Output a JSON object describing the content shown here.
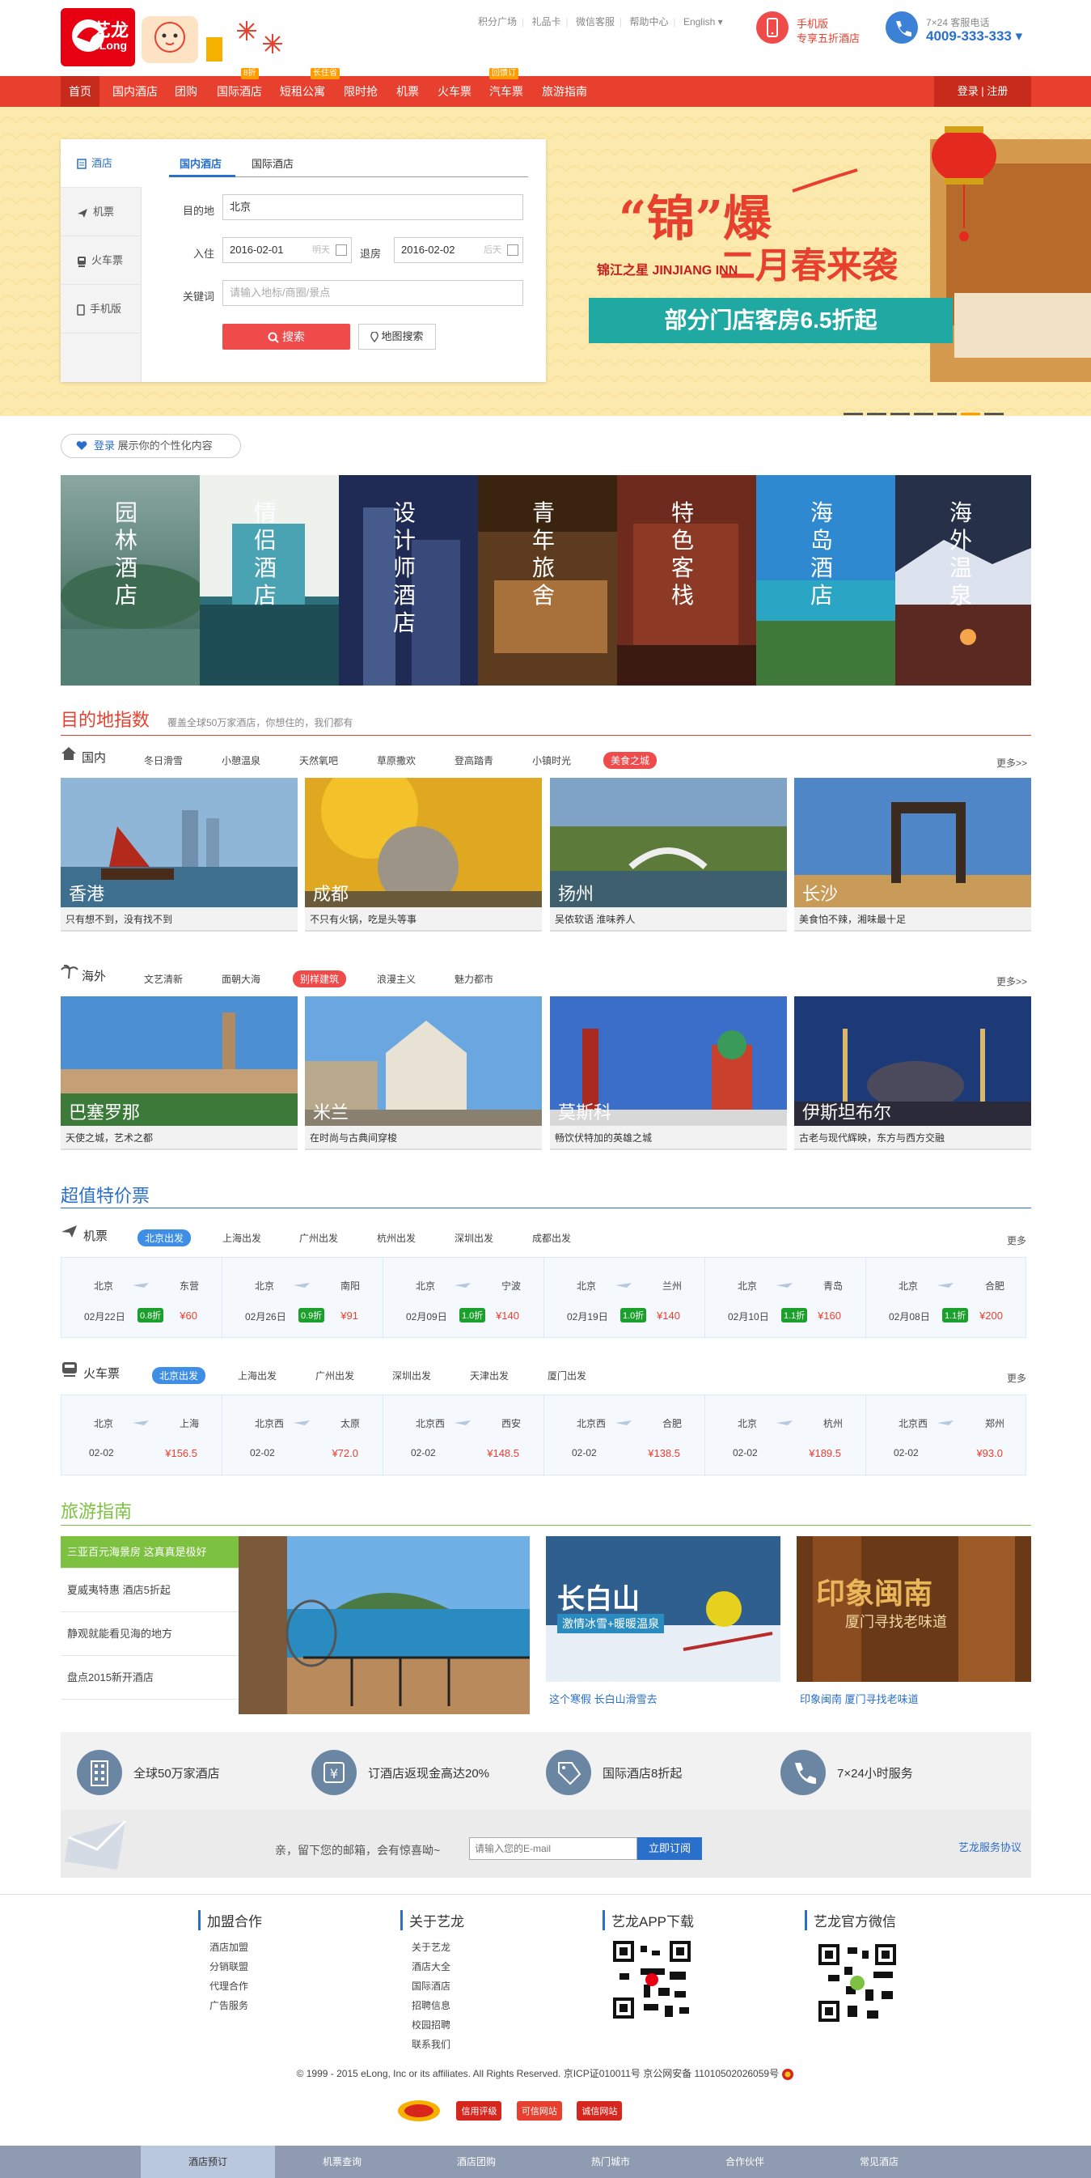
{
  "header": {
    "logo_text": "艺龙",
    "logo_sub": "eLong",
    "top_links": [
      "积分广场",
      "礼品卡",
      "微信客服",
      "帮助中心",
      "English ▾"
    ],
    "mobile_promo": {
      "line1": "手机版",
      "line2": "专享五折酒店"
    },
    "hotline": {
      "label": "7×24 客服电话",
      "number": "4009-333-333 ▾"
    }
  },
  "nav": {
    "items": [
      {
        "label": "首页",
        "badge": ""
      },
      {
        "label": "国内酒店",
        "badge": ""
      },
      {
        "label": "团购",
        "badge": ""
      },
      {
        "label": "国际酒店",
        "badge": "8折"
      },
      {
        "label": "短租公寓",
        "badge": "长住省"
      },
      {
        "label": "限时抢",
        "badge": ""
      },
      {
        "label": "机票",
        "badge": ""
      },
      {
        "label": "火车票",
        "badge": ""
      },
      {
        "label": "汽车票",
        "badge": "回馈订"
      },
      {
        "label": "旅游指南",
        "badge": ""
      }
    ],
    "login_text": "登录 | 注册"
  },
  "search": {
    "side_tabs": [
      "酒店",
      "机票",
      "火车票",
      "手机版"
    ],
    "sub_tabs": [
      "国内酒店",
      "国际酒店"
    ],
    "dest_label": "目的地",
    "dest_value": "北京",
    "checkin_label": "入住",
    "checkin_value": "2016-02-01",
    "checkin_hint": "明天",
    "checkout_label": "退房",
    "checkout_value": "2016-02-02",
    "checkout_hint": "后天",
    "keyword_label": "关键词",
    "keyword_placeholder": "请输入地标/商圈/景点",
    "search_btn": "搜索",
    "map_btn": "地图搜索"
  },
  "banner": {
    "title": "“锦”爆",
    "subtitle": "二月春来袭",
    "brand": "锦江之星 JINJIANG INN",
    "ribbon": "部分门店客房6.5折起"
  },
  "personal": {
    "link": "登录",
    "text": "展示你的个性化内容"
  },
  "themes": [
    "园林酒店",
    "情侣酒店",
    "设计师酒店",
    "青年旅舍",
    "特色客栈",
    "海岛酒店",
    "海外温泉"
  ],
  "destinations": {
    "title": "目的地指数",
    "desc": "覆盖全球50万家酒店，你想住的，我们都有",
    "domestic": {
      "label": "国内",
      "tabs": [
        "冬日滑雪",
        "小憩温泉",
        "天然氧吧",
        "草原撒欢",
        "登高踏青",
        "小镇时光",
        "美食之城"
      ],
      "more": "更多>>",
      "cards": [
        {
          "city": "香港",
          "caption": "只有想不到，没有找不到"
        },
        {
          "city": "成都",
          "caption": "不只有火锅，吃是头等事"
        },
        {
          "city": "扬州",
          "caption": "吴侬软语 淮味养人"
        },
        {
          "city": "长沙",
          "caption": "美食怕不辣，湘味最十足"
        }
      ]
    },
    "overseas": {
      "label": "海外",
      "tabs": [
        "文艺清新",
        "面朝大海",
        "别样建筑",
        "浪漫主义",
        "魅力都市"
      ],
      "more": "更多>>",
      "cards": [
        {
          "city": "巴塞罗那",
          "caption": "天使之城，艺术之都"
        },
        {
          "city": "米兰",
          "caption": "在时尚与古典间穿梭"
        },
        {
          "city": "莫斯科",
          "caption": "畅饮伏特加的英雄之城"
        },
        {
          "city": "伊斯坦布尔",
          "caption": "古老与现代辉映，东方与西方交融"
        }
      ]
    }
  },
  "deals": {
    "title": "超值特价票",
    "flights": {
      "label": "机票",
      "tabs": [
        "北京出发",
        "上海出发",
        "广州出发",
        "杭州出发",
        "深圳出发",
        "成都出发"
      ],
      "more": "更多",
      "items": [
        {
          "from": "北京",
          "to": "东营",
          "date": "02月22日",
          "discount": "0.8折",
          "price": "¥60"
        },
        {
          "from": "北京",
          "to": "南阳",
          "date": "02月26日",
          "discount": "0.9折",
          "price": "¥91"
        },
        {
          "from": "北京",
          "to": "宁波",
          "date": "02月09日",
          "discount": "1.0折",
          "price": "¥140"
        },
        {
          "from": "北京",
          "to": "兰州",
          "date": "02月19日",
          "discount": "1.0折",
          "price": "¥140"
        },
        {
          "from": "北京",
          "to": "青岛",
          "date": "02月10日",
          "discount": "1.1折",
          "price": "¥160"
        },
        {
          "from": "北京",
          "to": "合肥",
          "date": "02月08日",
          "discount": "1.1折",
          "price": "¥200"
        }
      ]
    },
    "trains": {
      "label": "火车票",
      "tabs": [
        "北京出发",
        "上海出发",
        "广州出发",
        "深圳出发",
        "天津出发",
        "厦门出发"
      ],
      "more": "更多",
      "items": [
        {
          "from": "北京",
          "to": "上海",
          "date": "02-02",
          "price": "¥156.5"
        },
        {
          "from": "北京西",
          "to": "太原",
          "date": "02-02",
          "price": "¥72.0"
        },
        {
          "from": "北京西",
          "to": "西安",
          "date": "02-02",
          "price": "¥148.5"
        },
        {
          "from": "北京西",
          "to": "合肥",
          "date": "02-02",
          "price": "¥138.5"
        },
        {
          "from": "北京",
          "to": "杭州",
          "date": "02-02",
          "price": "¥189.5"
        },
        {
          "from": "北京西",
          "to": "郑州",
          "date": "02-02",
          "price": "¥93.0"
        }
      ]
    }
  },
  "guide": {
    "title": "旅游指南",
    "list": [
      "三亚百元海景房 这真真是极好",
      "夏威夷特惠 酒店5折起",
      "静观就能看见海的地方",
      "盘点2015新开酒店"
    ],
    "card1_caption": "这个寒假 长白山滑雪去",
    "card1_title": "长白山",
    "card1_sub": "激情冰雪+暖暖温泉",
    "card2_caption": "印象闽南 厦门寻找老味道",
    "card2_title": "印象闽南",
    "card2_sub": "厦门寻找老味道"
  },
  "features": {
    "items": [
      "全球50万家酒店",
      "订酒店返现金高达20%",
      "国际酒店8折起",
      "7×24小时服务"
    ],
    "subscribe_text": "亲，留下您的邮箱，会有惊喜呦~",
    "email_placeholder": "请输入您的E-mail",
    "subscribe_btn": "立即订阅",
    "agreement": "艺龙服务协议"
  },
  "footer": {
    "cols": [
      {
        "title": "加盟合作",
        "links": [
          "酒店加盟",
          "分销联盟",
          "代理合作",
          "广告服务"
        ]
      },
      {
        "title": "关于艺龙",
        "links": [
          "关于艺龙",
          "酒店大全",
          "国际酒店",
          "招聘信息",
          "校园招聘",
          "联系我们"
        ]
      },
      {
        "title": "艺龙APP下载",
        "links": []
      },
      {
        "title": "艺龙官方微信",
        "links": []
      }
    ],
    "copyright": "© 1999 - 2015 eLong, Inc or its affiliates. All Rights Reserved. 京ICP证010011号 京公网安备 11010502026059号",
    "badges": [
      "信用评级",
      "可信网站",
      "诚信网站"
    ],
    "bottom_tabs": [
      "酒店预订",
      "机票查询",
      "酒店团购",
      "热门城市",
      "合作伙伴",
      "常见酒店"
    ]
  },
  "colors": {
    "brand_red": "#e8402f",
    "brand_blue": "#2a6fc9",
    "green": "#7cc240",
    "discount_green": "#1aa02b"
  }
}
